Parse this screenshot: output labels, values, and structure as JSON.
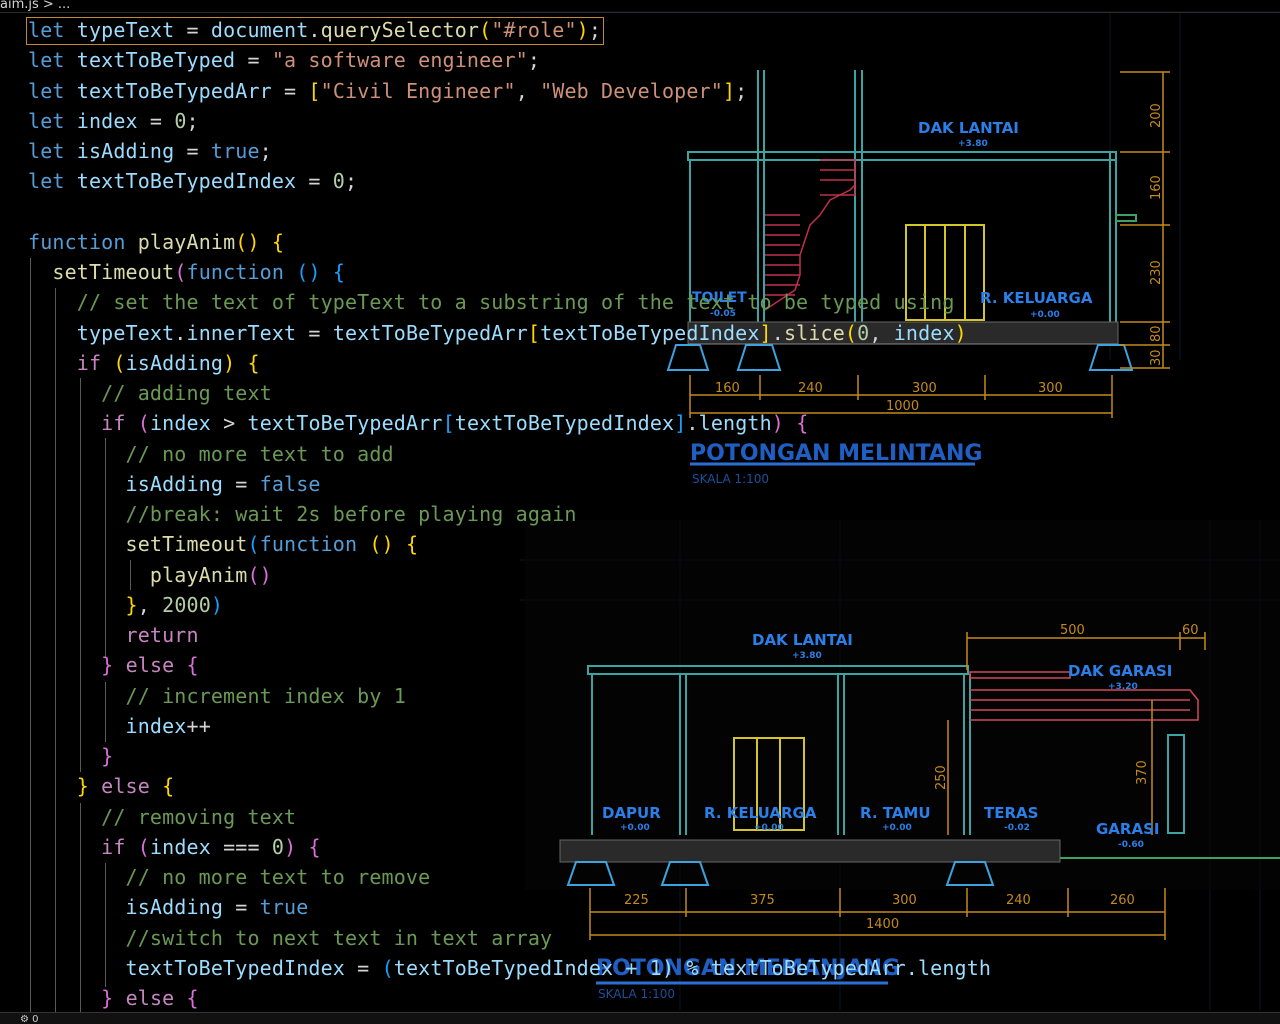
{
  "breadcrumb": "aim.js > ...",
  "status": {
    "icon": "bell-icon",
    "text": "⚙ 0"
  },
  "code_lines": [
    [
      {
        "t": "let",
        "c": "kw"
      },
      {
        "t": " typeText ",
        "c": "var"
      },
      {
        "t": "= ",
        "c": "p"
      },
      {
        "t": "document",
        "c": "var"
      },
      {
        "t": ".",
        "c": "p"
      },
      {
        "t": "querySelector",
        "c": "fn"
      },
      {
        "t": "(",
        "c": "b1"
      },
      {
        "t": "\"#role\"",
        "c": "str"
      },
      {
        "t": ")",
        "c": "b1"
      },
      {
        "t": ";",
        "c": "p"
      }
    ],
    [
      {
        "t": "let",
        "c": "kw"
      },
      {
        "t": " textToBeTyped ",
        "c": "var"
      },
      {
        "t": "= ",
        "c": "p"
      },
      {
        "t": "\"a software engineer\"",
        "c": "str"
      },
      {
        "t": ";",
        "c": "p"
      }
    ],
    [
      {
        "t": "let",
        "c": "kw"
      },
      {
        "t": " textToBeTypedArr ",
        "c": "var"
      },
      {
        "t": "= ",
        "c": "p"
      },
      {
        "t": "[",
        "c": "b1"
      },
      {
        "t": "\"Civil Engineer\"",
        "c": "str"
      },
      {
        "t": ", ",
        "c": "p"
      },
      {
        "t": "\"Web Developer\"",
        "c": "str"
      },
      {
        "t": "]",
        "c": "b1"
      },
      {
        "t": ";",
        "c": "p"
      }
    ],
    [
      {
        "t": "let",
        "c": "kw"
      },
      {
        "t": " index ",
        "c": "var"
      },
      {
        "t": "= ",
        "c": "p"
      },
      {
        "t": "0",
        "c": "num"
      },
      {
        "t": ";",
        "c": "p"
      }
    ],
    [
      {
        "t": "let",
        "c": "kw"
      },
      {
        "t": " isAdding ",
        "c": "var"
      },
      {
        "t": "= ",
        "c": "p"
      },
      {
        "t": "true",
        "c": "kw"
      },
      {
        "t": ";",
        "c": "p"
      }
    ],
    [
      {
        "t": "let",
        "c": "kw"
      },
      {
        "t": " textToBeTypedIndex ",
        "c": "var"
      },
      {
        "t": "= ",
        "c": "p"
      },
      {
        "t": "0",
        "c": "num"
      },
      {
        "t": ";",
        "c": "p"
      }
    ],
    [],
    [
      {
        "t": "function",
        "c": "kw"
      },
      {
        "t": " ",
        "c": "p"
      },
      {
        "t": "playAnim",
        "c": "fn"
      },
      {
        "t": "()",
        "c": "b1"
      },
      {
        "t": " ",
        "c": "p"
      },
      {
        "t": "{",
        "c": "b1"
      }
    ],
    [
      {
        "t": "  ",
        "c": "p"
      },
      {
        "t": "setTimeout",
        "c": "fn"
      },
      {
        "t": "(",
        "c": "b2"
      },
      {
        "t": "function",
        "c": "kw"
      },
      {
        "t": " ",
        "c": "p"
      },
      {
        "t": "()",
        "c": "b3"
      },
      {
        "t": " ",
        "c": "p"
      },
      {
        "t": "{",
        "c": "b3"
      }
    ],
    [
      {
        "t": "    ",
        "c": "p"
      },
      {
        "t": "// set the text of typeText to a substring of the text to be typed using",
        "c": "cmt"
      }
    ],
    [
      {
        "t": "    ",
        "c": "p"
      },
      {
        "t": "typeText",
        "c": "var"
      },
      {
        "t": ".",
        "c": "p"
      },
      {
        "t": "innerText",
        "c": "var"
      },
      {
        "t": " = ",
        "c": "p"
      },
      {
        "t": "textToBeTypedArr",
        "c": "var"
      },
      {
        "t": "[",
        "c": "b1"
      },
      {
        "t": "textToBeTypedIndex",
        "c": "var"
      },
      {
        "t": "]",
        "c": "b1"
      },
      {
        "t": ".",
        "c": "p"
      },
      {
        "t": "slice",
        "c": "fn"
      },
      {
        "t": "(",
        "c": "b1"
      },
      {
        "t": "0",
        "c": "num"
      },
      {
        "t": ", ",
        "c": "p"
      },
      {
        "t": "index",
        "c": "var"
      },
      {
        "t": ")",
        "c": "b1"
      }
    ],
    [
      {
        "t": "    ",
        "c": "p"
      },
      {
        "t": "if",
        "c": "ctl"
      },
      {
        "t": " ",
        "c": "p"
      },
      {
        "t": "(",
        "c": "b1"
      },
      {
        "t": "isAdding",
        "c": "var"
      },
      {
        "t": ")",
        "c": "b1"
      },
      {
        "t": " ",
        "c": "p"
      },
      {
        "t": "{",
        "c": "b1"
      }
    ],
    [
      {
        "t": "      ",
        "c": "p"
      },
      {
        "t": "// adding text",
        "c": "cmt"
      }
    ],
    [
      {
        "t": "      ",
        "c": "p"
      },
      {
        "t": "if",
        "c": "ctl"
      },
      {
        "t": " ",
        "c": "p"
      },
      {
        "t": "(",
        "c": "b2"
      },
      {
        "t": "index",
        "c": "var"
      },
      {
        "t": " > ",
        "c": "p"
      },
      {
        "t": "textToBeTypedArr",
        "c": "var"
      },
      {
        "t": "[",
        "c": "b3"
      },
      {
        "t": "textToBeTypedIndex",
        "c": "var"
      },
      {
        "t": "]",
        "c": "b3"
      },
      {
        "t": ".",
        "c": "p"
      },
      {
        "t": "length",
        "c": "var"
      },
      {
        "t": ")",
        "c": "b2"
      },
      {
        "t": " ",
        "c": "p"
      },
      {
        "t": "{",
        "c": "b2"
      }
    ],
    [
      {
        "t": "        ",
        "c": "p"
      },
      {
        "t": "// no more text to add",
        "c": "cmt"
      }
    ],
    [
      {
        "t": "        ",
        "c": "p"
      },
      {
        "t": "isAdding",
        "c": "var"
      },
      {
        "t": " = ",
        "c": "p"
      },
      {
        "t": "false",
        "c": "kw"
      }
    ],
    [
      {
        "t": "        ",
        "c": "p"
      },
      {
        "t": "//break: wait 2s before playing again",
        "c": "cmt"
      }
    ],
    [
      {
        "t": "        ",
        "c": "p"
      },
      {
        "t": "setTimeout",
        "c": "fn"
      },
      {
        "t": "(",
        "c": "b3"
      },
      {
        "t": "function",
        "c": "kw"
      },
      {
        "t": " ",
        "c": "p"
      },
      {
        "t": "()",
        "c": "b1"
      },
      {
        "t": " ",
        "c": "p"
      },
      {
        "t": "{",
        "c": "b1"
      }
    ],
    [
      {
        "t": "          ",
        "c": "p"
      },
      {
        "t": "playAnim",
        "c": "fn"
      },
      {
        "t": "()",
        "c": "b2"
      }
    ],
    [
      {
        "t": "        ",
        "c": "p"
      },
      {
        "t": "}",
        "c": "b1"
      },
      {
        "t": ", ",
        "c": "p"
      },
      {
        "t": "2000",
        "c": "num"
      },
      {
        "t": ")",
        "c": "b3"
      }
    ],
    [
      {
        "t": "        ",
        "c": "p"
      },
      {
        "t": "return",
        "c": "ctl"
      }
    ],
    [
      {
        "t": "      ",
        "c": "p"
      },
      {
        "t": "}",
        "c": "b2"
      },
      {
        "t": " ",
        "c": "p"
      },
      {
        "t": "else",
        "c": "ctl"
      },
      {
        "t": " ",
        "c": "p"
      },
      {
        "t": "{",
        "c": "b2"
      }
    ],
    [
      {
        "t": "        ",
        "c": "p"
      },
      {
        "t": "// increment index by 1",
        "c": "cmt"
      }
    ],
    [
      {
        "t": "        ",
        "c": "p"
      },
      {
        "t": "index",
        "c": "var"
      },
      {
        "t": "++",
        "c": "p"
      }
    ],
    [
      {
        "t": "      ",
        "c": "p"
      },
      {
        "t": "}",
        "c": "b2"
      }
    ],
    [
      {
        "t": "    ",
        "c": "p"
      },
      {
        "t": "}",
        "c": "b1"
      },
      {
        "t": " ",
        "c": "p"
      },
      {
        "t": "else",
        "c": "ctl"
      },
      {
        "t": " ",
        "c": "p"
      },
      {
        "t": "{",
        "c": "b1"
      }
    ],
    [
      {
        "t": "      ",
        "c": "p"
      },
      {
        "t": "// removing text",
        "c": "cmt"
      }
    ],
    [
      {
        "t": "      ",
        "c": "p"
      },
      {
        "t": "if",
        "c": "ctl"
      },
      {
        "t": " ",
        "c": "p"
      },
      {
        "t": "(",
        "c": "b2"
      },
      {
        "t": "index",
        "c": "var"
      },
      {
        "t": " === ",
        "c": "p"
      },
      {
        "t": "0",
        "c": "num"
      },
      {
        "t": ")",
        "c": "b2"
      },
      {
        "t": " ",
        "c": "p"
      },
      {
        "t": "{",
        "c": "b2"
      }
    ],
    [
      {
        "t": "        ",
        "c": "p"
      },
      {
        "t": "// no more text to remove",
        "c": "cmt"
      }
    ],
    [
      {
        "t": "        ",
        "c": "p"
      },
      {
        "t": "isAdding",
        "c": "var"
      },
      {
        "t": " = ",
        "c": "p"
      },
      {
        "t": "true",
        "c": "kw"
      }
    ],
    [
      {
        "t": "        ",
        "c": "p"
      },
      {
        "t": "//switch to next text in text array",
        "c": "cmt"
      }
    ],
    [
      {
        "t": "        ",
        "c": "p"
      },
      {
        "t": "textToBeTypedIndex",
        "c": "var"
      },
      {
        "t": " = ",
        "c": "p"
      },
      {
        "t": "(",
        "c": "b3"
      },
      {
        "t": "textToBeTypedIndex + 1) % textToBeTypedArr.length",
        "c": "var"
      }
    ],
    [
      {
        "t": "      ",
        "c": "p"
      },
      {
        "t": "}",
        "c": "b2"
      },
      {
        "t": " ",
        "c": "p"
      },
      {
        "t": "else",
        "c": "ctl"
      },
      {
        "t": " ",
        "c": "p"
      },
      {
        "t": "{",
        "c": "b2"
      }
    ]
  ],
  "cad": {
    "section1": {
      "title": "POTONGAN MELINTANG",
      "scale": "SKALA 1:100",
      "labels": {
        "dak": "DAK LANTAI",
        "dak_lvl": "+3.80",
        "toilet": "TOILET",
        "toilet_lvl": "-0.05",
        "keluarga": "R. KELUARGA",
        "keluarga_lvl": "+0.00"
      },
      "dims_bottom": [
        "160",
        "240",
        "300",
        "300"
      ],
      "dim_total": "1000",
      "dims_right": [
        "200",
        "160",
        "230",
        "80",
        "30"
      ]
    },
    "section2": {
      "title": "POTONGAN MEMANJANG",
      "scale": "SKALA 1:100",
      "labels": {
        "dak": "DAK LANTAI",
        "dak_lvl": "+3.80",
        "dak_garasi": "DAK GARASI",
        "dak_garasi_lvl": "+3.20",
        "dapur": "DAPUR",
        "dapur_lvl": "+0.00",
        "keluarga": "R. KELUARGA",
        "keluarga_lvl": "+0.00",
        "tamu": "R. TAMU",
        "tamu_lvl": "+0.00",
        "teras": "TERAS",
        "teras_lvl": "-0.02",
        "garasi": "GARASI",
        "garasi_lvl": "-0.60"
      },
      "dims_bottom": [
        "225",
        "375",
        "300",
        "240",
        "260"
      ],
      "dim_total": "1400",
      "dims_top": [
        "500",
        "60"
      ],
      "dim_v1": "250",
      "dim_v2": "370"
    }
  }
}
